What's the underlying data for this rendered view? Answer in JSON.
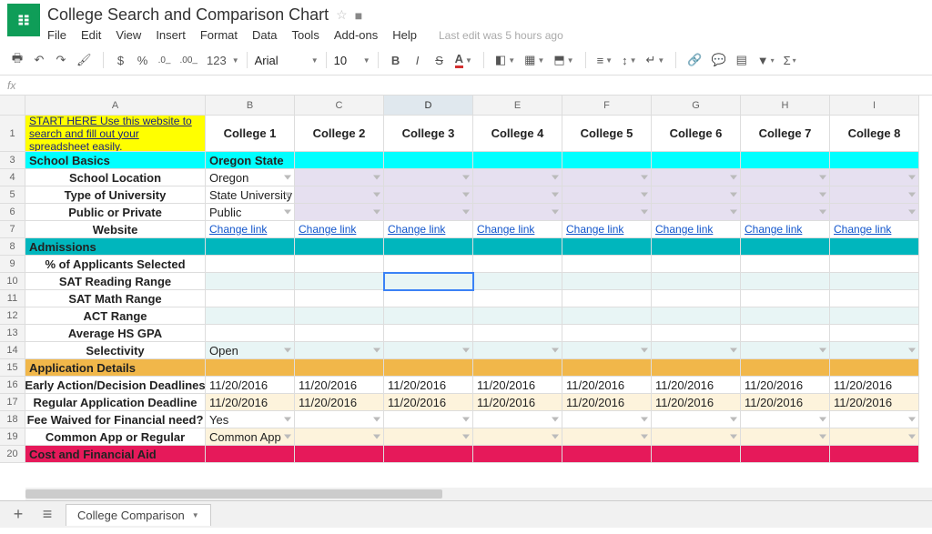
{
  "doc_title": "College Search and Comparison Chart",
  "last_edit": "Last edit was 5 hours ago",
  "menus": [
    "File",
    "Edit",
    "View",
    "Insert",
    "Format",
    "Data",
    "Tools",
    "Add-ons",
    "Help"
  ],
  "toolbar": {
    "currency": "$",
    "percent": "%",
    "dec_dec": ".0←",
    "dec_inc": ".00→",
    "number_format": "123",
    "font": "Arial",
    "font_size": "10",
    "link_icon": "⧉",
    "filter": "▼"
  },
  "fx_label": "fx",
  "columns": [
    "A",
    "B",
    "C",
    "D",
    "E",
    "F",
    "G",
    "H",
    "I"
  ],
  "selected_col": "D",
  "selected_cell": {
    "row": 10,
    "col": "D"
  },
  "rows": [
    {
      "n": 1,
      "h": 40,
      "a": {
        "t": "START HERE Use this website to search and fill out your spreadsheet easily.",
        "cls": "bg-yellow",
        "link": true
      },
      "hdr": [
        "College 1",
        "College 2",
        "College 3",
        "College 4",
        "College 5",
        "College 6",
        "College 7",
        "College 8"
      ],
      "hdr_cls": "bold center"
    },
    {
      "n": 3,
      "a": {
        "t": "School Basics",
        "cls": "bg-cyan bold"
      },
      "b": {
        "t": "Oregon State",
        "cls": "bg-cyan bold"
      },
      "rest_cls": "bg-cyan"
    },
    {
      "n": 4,
      "a": {
        "t": "School Location",
        "cls": "bold center"
      },
      "b": {
        "t": "Oregon",
        "dd": true
      },
      "rest_cls": "bg-lav",
      "rest_dd": true,
      "b_cls": ""
    },
    {
      "n": 5,
      "a": {
        "t": "Type of University",
        "cls": "bold center"
      },
      "b": {
        "t": "State University",
        "dd": true
      },
      "rest_cls": "bg-lav",
      "rest_dd": true
    },
    {
      "n": 6,
      "a": {
        "t": "Public or Private",
        "cls": "bold center"
      },
      "b": {
        "t": "Public",
        "dd": true
      },
      "rest_cls": "bg-lav",
      "rest_dd": true
    },
    {
      "n": 7,
      "a": {
        "t": "Website",
        "cls": "bold center"
      },
      "all_link": "Change link"
    },
    {
      "n": 8,
      "a": {
        "t": "Admissions",
        "cls": "bg-teal bold"
      },
      "rest_cls": "bg-teal",
      "b_cls": "bg-teal"
    },
    {
      "n": 9,
      "a": {
        "t": "% of Applicants Selected",
        "cls": "bold center"
      },
      "rest_cls": ""
    },
    {
      "n": 10,
      "a": {
        "t": "SAT Reading Range",
        "cls": "bold center"
      },
      "rest_cls": "bg-pale-cyan",
      "b_cls": "bg-pale-cyan"
    },
    {
      "n": 11,
      "a": {
        "t": "SAT Math Range",
        "cls": "bold center"
      }
    },
    {
      "n": 12,
      "a": {
        "t": "ACT Range",
        "cls": "bold center"
      },
      "rest_cls": "bg-pale-cyan",
      "b_cls": "bg-pale-cyan"
    },
    {
      "n": 13,
      "a": {
        "t": "Average HS GPA",
        "cls": "bold center"
      }
    },
    {
      "n": 14,
      "a": {
        "t": "Selectivity",
        "cls": "bold center"
      },
      "b": {
        "t": "Open",
        "dd": true,
        "cls": "bg-pale-cyan"
      },
      "rest_cls": "bg-pale-cyan",
      "rest_dd": true
    },
    {
      "n": 15,
      "a": {
        "t": "Application Details",
        "cls": "bg-amber bold"
      },
      "rest_cls": "bg-amber",
      "b_cls": "bg-amber"
    },
    {
      "n": 16,
      "a": {
        "t": "Early Action/Decision Deadlines",
        "cls": "bold center"
      },
      "all_text": "11/20/2016"
    },
    {
      "n": 17,
      "a": {
        "t": "Regular Application Deadline",
        "cls": "bold center"
      },
      "all_text": "11/20/2016",
      "rest_cls": "bg-cream",
      "b_cls": "bg-cream"
    },
    {
      "n": 18,
      "a": {
        "t": "Fee Waived for Financial need?",
        "cls": "bold center"
      },
      "b": {
        "t": "Yes",
        "dd": true
      },
      "rest_dd": true
    },
    {
      "n": 19,
      "a": {
        "t": "Common App or Regular",
        "cls": "bold center"
      },
      "b": {
        "t": "Common App",
        "dd": true,
        "cls": "bg-cream"
      },
      "rest_cls": "bg-cream",
      "rest_dd": true
    },
    {
      "n": 20,
      "a": {
        "t": "Cost and Financial Aid",
        "cls": "bg-pink bold"
      },
      "rest_cls": "bg-pink",
      "b_cls": "bg-pink"
    }
  ],
  "sheet_tab": "College Comparison",
  "add_label": "+",
  "menu_icon": "≡"
}
